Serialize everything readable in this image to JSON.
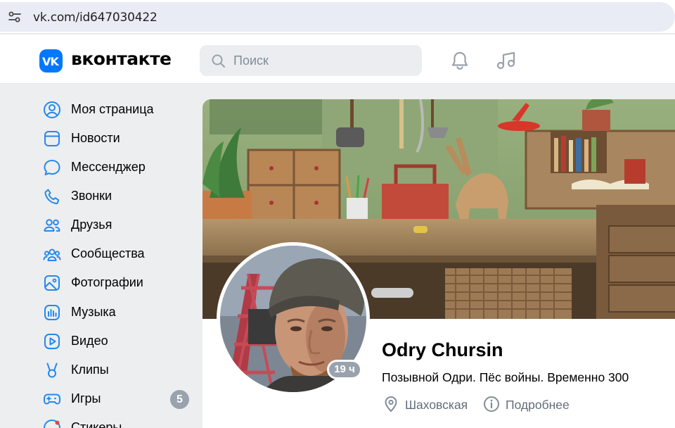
{
  "browser": {
    "url": "vk.com/id647030422"
  },
  "header": {
    "logo_text": "вконтакте",
    "search_placeholder": "Поиск"
  },
  "sidebar": {
    "items": [
      {
        "label": "Моя страница",
        "icon": "user-circle-icon"
      },
      {
        "label": "Новости",
        "icon": "news-feed-icon"
      },
      {
        "label": "Мессенджер",
        "icon": "message-bubble-icon"
      },
      {
        "label": "Звонки",
        "icon": "phone-icon"
      },
      {
        "label": "Друзья",
        "icon": "friends-icon"
      },
      {
        "label": "Сообщества",
        "icon": "communities-icon"
      },
      {
        "label": "Фотографии",
        "icon": "photo-icon"
      },
      {
        "label": "Музыка",
        "icon": "music-icon"
      },
      {
        "label": "Видео",
        "icon": "video-icon"
      },
      {
        "label": "Клипы",
        "icon": "clips-icon"
      },
      {
        "label": "Игры",
        "icon": "gamepad-icon",
        "badge": "5"
      },
      {
        "label": "Стикеры",
        "icon": "stickers-icon"
      }
    ]
  },
  "profile": {
    "name": "Odry Chursin",
    "status": "Позывной Одри. Пёс войны. Временно 300",
    "online": "19 ч",
    "location": "Шаховская",
    "details_label": "Подробнее"
  },
  "colors": {
    "accent": "#0077ff",
    "badge": "#99a2ad",
    "icon": "#2688eb",
    "secondary_text": "#626d7a"
  }
}
